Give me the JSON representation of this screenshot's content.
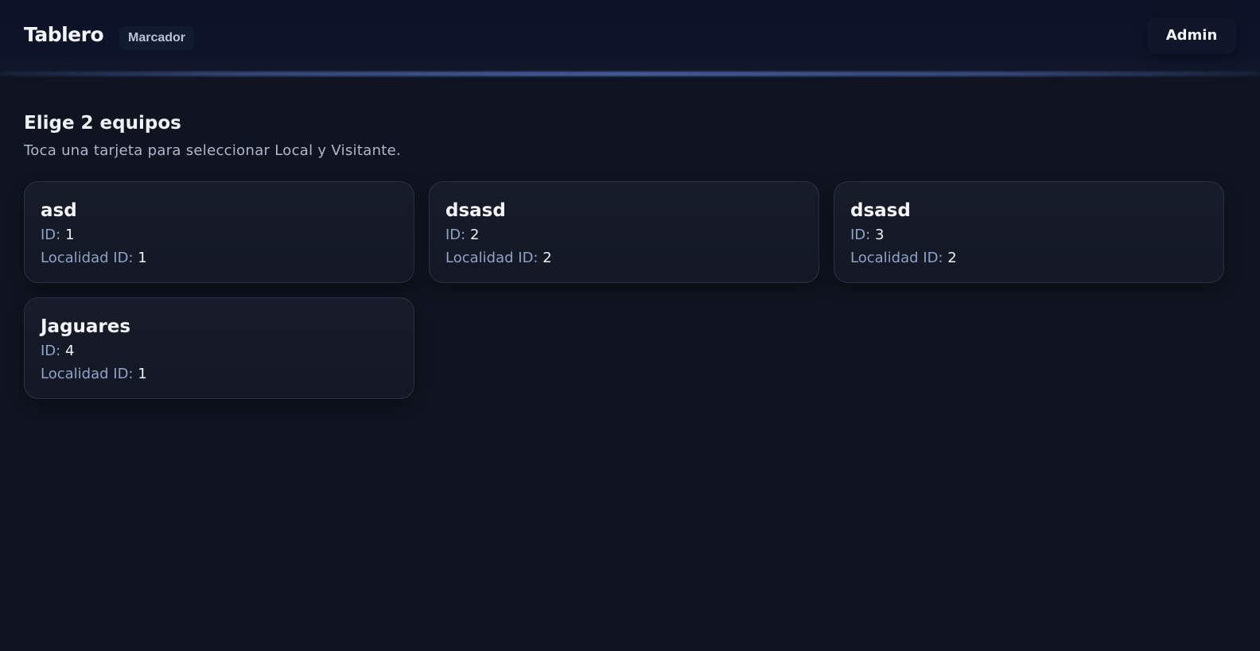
{
  "header": {
    "brand": "Tablero",
    "badge": "Marcador",
    "admin_label": "Admin"
  },
  "main": {
    "title": "Elige 2 equipos",
    "subtitle": "Toca una tarjeta para seleccionar Local y Visitante.",
    "id_label": "ID:",
    "locality_label": "Localidad ID:",
    "teams": [
      {
        "name": "asd",
        "id": "1",
        "locality_id": "1"
      },
      {
        "name": "dsasd",
        "id": "2",
        "locality_id": "2"
      },
      {
        "name": "dsasd",
        "id": "3",
        "locality_id": "2"
      },
      {
        "name": "Jaguares",
        "id": "4",
        "locality_id": "1"
      }
    ]
  },
  "colors": {
    "background": "#0f1420",
    "header_bg": "#0c1226",
    "card_bg": "#171c28",
    "card_border": "#2a3142",
    "label_color": "#8ea3c8",
    "text_color": "#eef1f7"
  }
}
